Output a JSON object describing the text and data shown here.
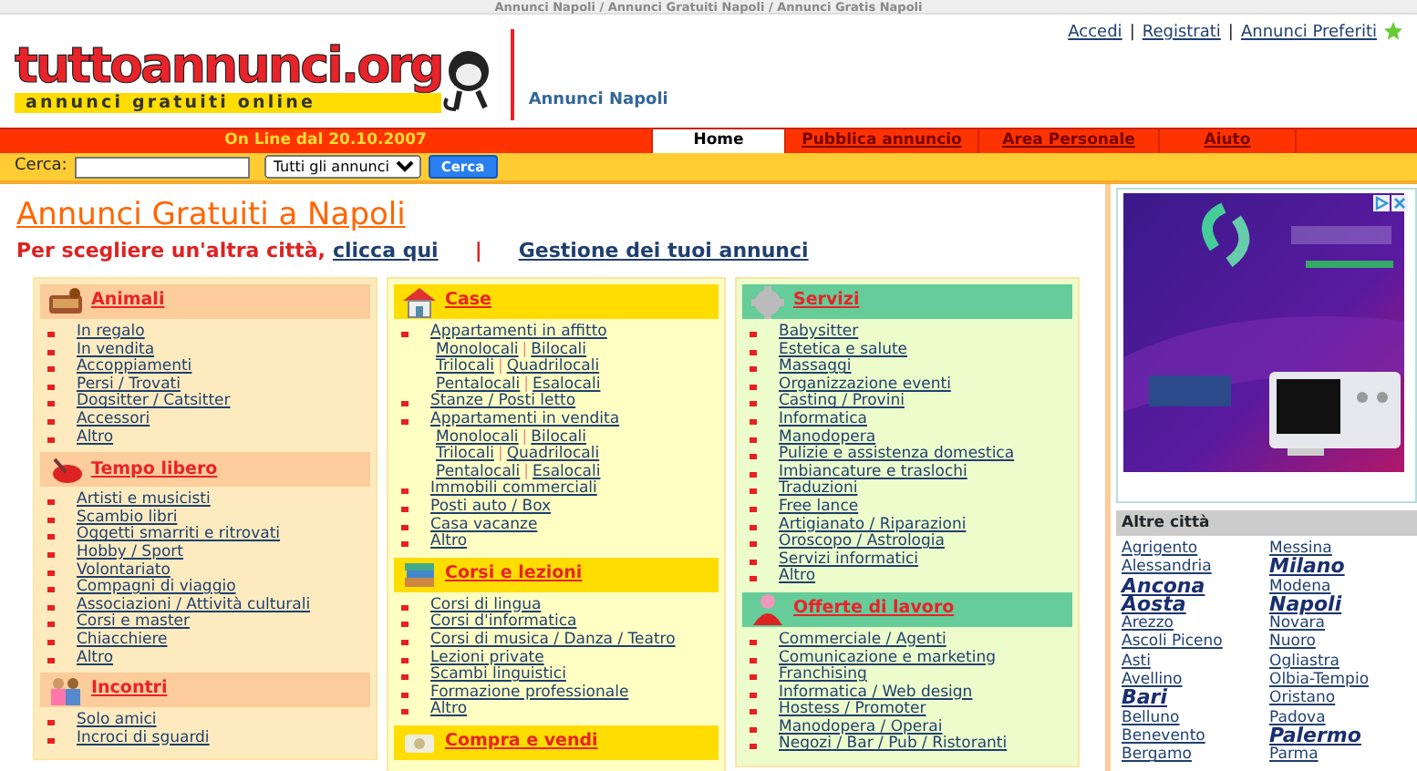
{
  "topbar": {
    "breadcrumb": "Annunci Napoli / Annunci Gratuiti Napoli / Annunci Gratis Napoli"
  },
  "header": {
    "logo_text": "tuttoannunci.org",
    "logo_tagline": "annunci gratuiti online",
    "city_label": "Annunci Napoli",
    "separator": "|",
    "links": [
      "Accedi",
      "Registrati",
      "Annunci Preferiti"
    ]
  },
  "nav": {
    "tagline": "On Line dal 20.10.2007",
    "tabs": [
      {
        "label": "Home",
        "selected": true
      },
      {
        "label": "Pubblica annuncio",
        "selected": false
      },
      {
        "label": "Area Personale",
        "selected": false
      },
      {
        "label": "Aiuto",
        "selected": false
      }
    ]
  },
  "search": {
    "label": "Cerca:",
    "category": "Tutti gli annunci",
    "button": "Cerca"
  },
  "main": {
    "title": "Annunci Gratuiti a Napoli",
    "subtitle": "Per scegliere un'altra città,",
    "city_link": "clicca qui",
    "separator": "|",
    "manage_link": "Gestione dei tuoi annunci"
  },
  "columns": [
    {
      "color": "#fdebbf",
      "sections": [
        {
          "title": "Animali",
          "color": "#fdcc9b",
          "items": [
            {
              "label": "In regalo"
            },
            {
              "label": "In vendita"
            },
            {
              "label": "Accoppiamenti"
            },
            {
              "label": "Persi / Trovati"
            },
            {
              "label": "Dogsitter / Catsitter"
            },
            {
              "label": "Accessori"
            },
            {
              "label": "Altro"
            }
          ]
        },
        {
          "title": "Tempo libero",
          "color": "#fdcc9b",
          "items": [
            {
              "label": "Artisti e musicisti"
            },
            {
              "label": "Scambio libri"
            },
            {
              "label": "Oggetti smarriti e ritrovati"
            },
            {
              "label": "Hobby / Sport"
            },
            {
              "label": "Volontariato"
            },
            {
              "label": "Compagni di viaggio"
            },
            {
              "label": "Associazioni / Attività culturali"
            },
            {
              "label": "Corsi e master"
            },
            {
              "label": "Chiacchiere"
            },
            {
              "label": "Altro"
            }
          ]
        },
        {
          "title": "Incontri",
          "color": "#fdcc9b",
          "items": [
            {
              "label": "Solo amici"
            },
            {
              "label": "Incroci di sguardi"
            }
          ]
        }
      ]
    },
    {
      "color": "#ffffc4",
      "sections": [
        {
          "title": "Case",
          "color": "#ffdd00",
          "items": [
            {
              "label": "Appartamenti in affitto",
              "subs": [
                [
                  "Monolocali",
                  "Bilocali"
                ],
                [
                  "Trilocali",
                  "Quadrilocali"
                ],
                [
                  "Pentalocali",
                  "Esalocali"
                ]
              ]
            },
            {
              "label": "Stanze / Posti letto"
            },
            {
              "label": "Appartamenti in vendita",
              "subs": [
                [
                  "Monolocali",
                  "Bilocali"
                ],
                [
                  "Trilocali",
                  "Quadrilocali"
                ],
                [
                  "Pentalocali",
                  "Esalocali"
                ]
              ]
            },
            {
              "label": "Immobili commerciali"
            },
            {
              "label": "Posti auto / Box"
            },
            {
              "label": "Casa vacanze"
            },
            {
              "label": "Altro"
            }
          ]
        },
        {
          "title": "Corsi e lezioni",
          "color": "#ffdd00",
          "items": [
            {
              "label": "Corsi di lingua"
            },
            {
              "label": "Corsi d'informatica"
            },
            {
              "label": "Corsi di musica / Danza / Teatro"
            },
            {
              "label": "Lezioni private"
            },
            {
              "label": "Scambi linguistici"
            },
            {
              "label": "Formazione professionale"
            },
            {
              "label": "Altro"
            }
          ]
        },
        {
          "title": "Compra e vendi",
          "color": "#ffdd00"
        }
      ]
    },
    {
      "color": "#ecfccb",
      "sections": [
        {
          "title": "Servizi",
          "color": "#66cc99",
          "items": [
            {
              "label": "Babysitter"
            },
            {
              "label": "Estetica e salute"
            },
            {
              "label": "Massaggi"
            },
            {
              "label": "Organizzazione eventi"
            },
            {
              "label": "Casting / Provini"
            },
            {
              "label": "Informatica"
            },
            {
              "label": "Manodopera"
            },
            {
              "label": "Pulizie e assistenza domestica"
            },
            {
              "label": "Imbiancature e traslochi"
            },
            {
              "label": "Traduzioni"
            },
            {
              "label": "Free lance"
            },
            {
              "label": "Artigianato / Riparazioni"
            },
            {
              "label": "Oroscopo / Astrologia"
            },
            {
              "label": "Servizi informatici"
            },
            {
              "label": "Altro"
            }
          ]
        },
        {
          "title": "Offerte di lavoro",
          "color": "#66cc99",
          "items": [
            {
              "label": "Commerciale / Agenti"
            },
            {
              "label": "Comunicazione e marketing"
            },
            {
              "label": "Franchising"
            },
            {
              "label": "Informatica / Web design"
            },
            {
              "label": "Hostess / Promoter"
            },
            {
              "label": "Manodopera / Operai"
            },
            {
              "label": "Negozi / Bar / Pub / Ristoranti"
            }
          ]
        }
      ]
    }
  ],
  "sidebar": {
    "cities_title": "Altre città",
    "city_columns": [
      [
        {
          "name": "Agrigento",
          "major": false
        },
        {
          "name": "Alessandria",
          "major": false
        },
        {
          "name": "Ancona",
          "major": true
        },
        {
          "name": "Aosta",
          "major": true
        },
        {
          "name": "Arezzo",
          "major": false
        },
        {
          "name": "Ascoli Piceno",
          "major": false
        },
        {
          "name": "Asti",
          "major": false
        },
        {
          "name": "Avellino",
          "major": false
        },
        {
          "name": "Bari",
          "major": true
        },
        {
          "name": "Belluno",
          "major": false
        },
        {
          "name": "Benevento",
          "major": false
        },
        {
          "name": "Bergamo",
          "major": false
        }
      ],
      [
        {
          "name": "Messina",
          "major": false
        },
        {
          "name": "Milano",
          "major": true
        },
        {
          "name": "Modena",
          "major": false
        },
        {
          "name": "Napoli",
          "major": true
        },
        {
          "name": "Novara",
          "major": false
        },
        {
          "name": "Nuoro",
          "major": false
        },
        {
          "name": "Ogliastra",
          "major": false
        },
        {
          "name": "Olbia-Tempio",
          "major": false
        },
        {
          "name": "Oristano",
          "major": false
        },
        {
          "name": "Padova",
          "major": false
        },
        {
          "name": "Palermo",
          "major": true
        },
        {
          "name": "Parma",
          "major": false
        }
      ]
    ]
  }
}
